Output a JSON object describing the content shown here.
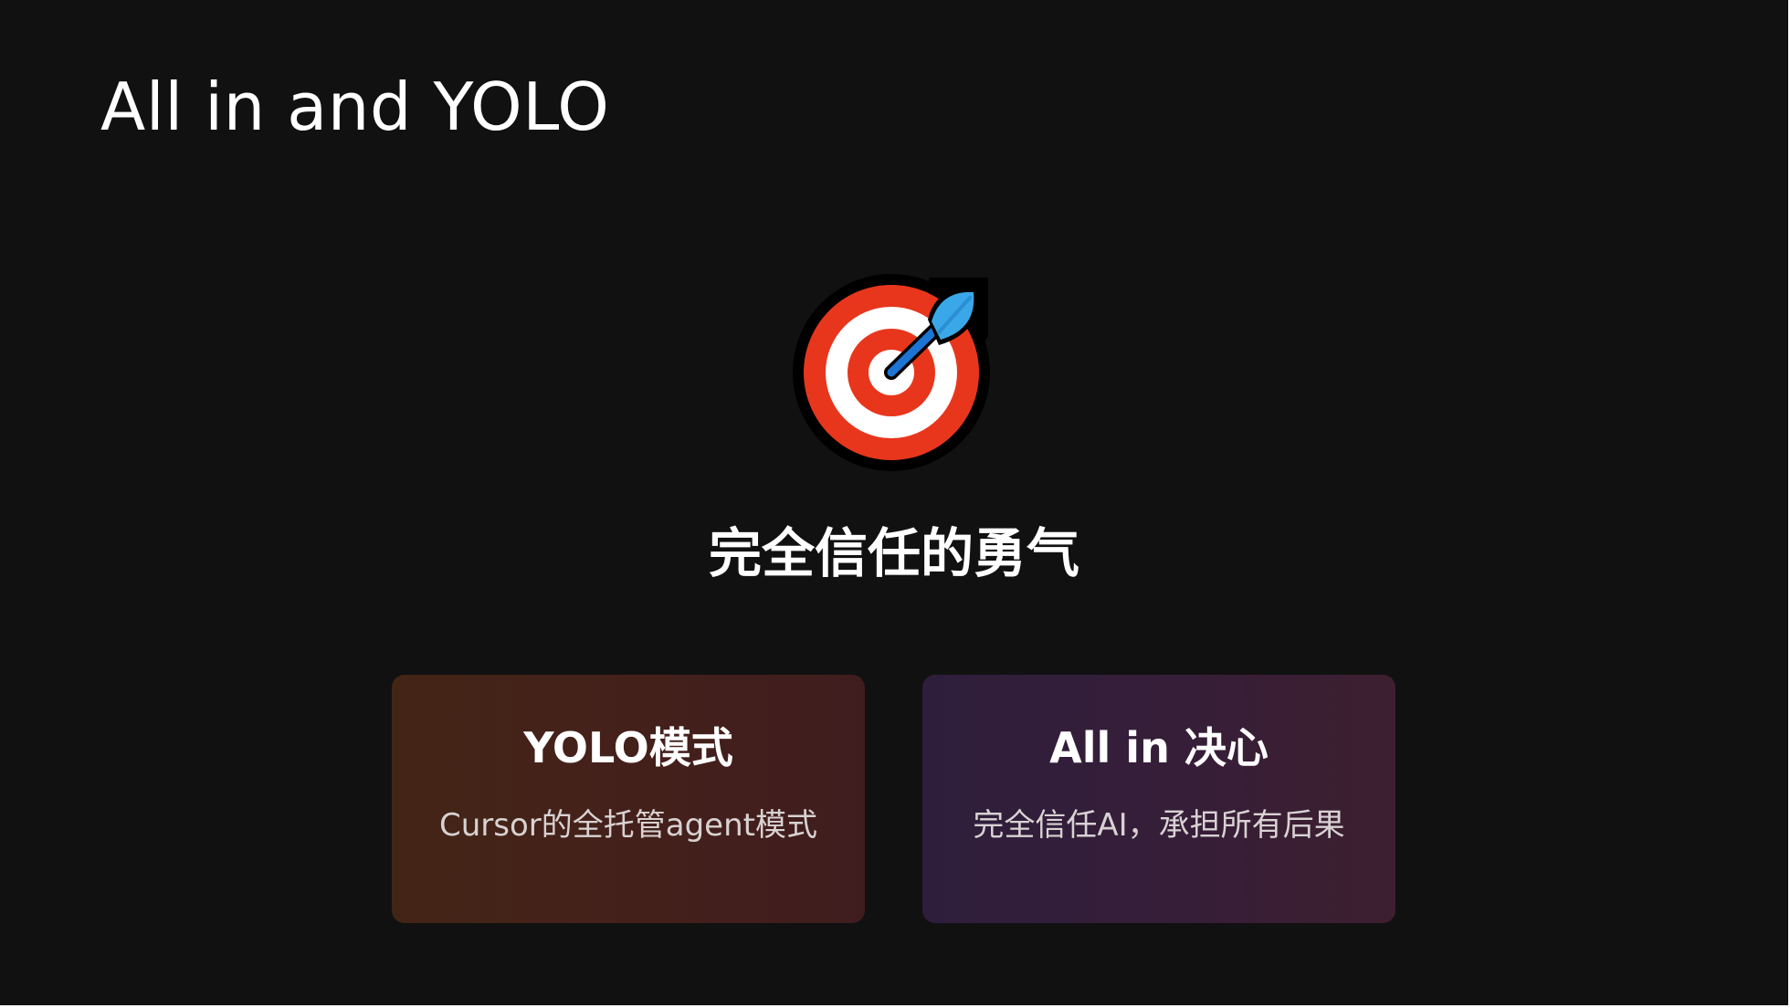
{
  "slide": {
    "title": "All in and YOLO",
    "icon": "direct-hit-target-icon",
    "headline": "完全信任的勇气"
  },
  "cards": [
    {
      "title": "YOLO模式",
      "description": "Cursor的全托管agent模式",
      "accent": "#432516"
    },
    {
      "title": "All in 决心",
      "description": "完全信任AI，承担所有后果",
      "accent": "#2e1e3c"
    }
  ],
  "colors": {
    "background": "#111111",
    "text": "#ffffff",
    "target_red": "#e8361c",
    "dart_blue": "#3aa8e8"
  }
}
